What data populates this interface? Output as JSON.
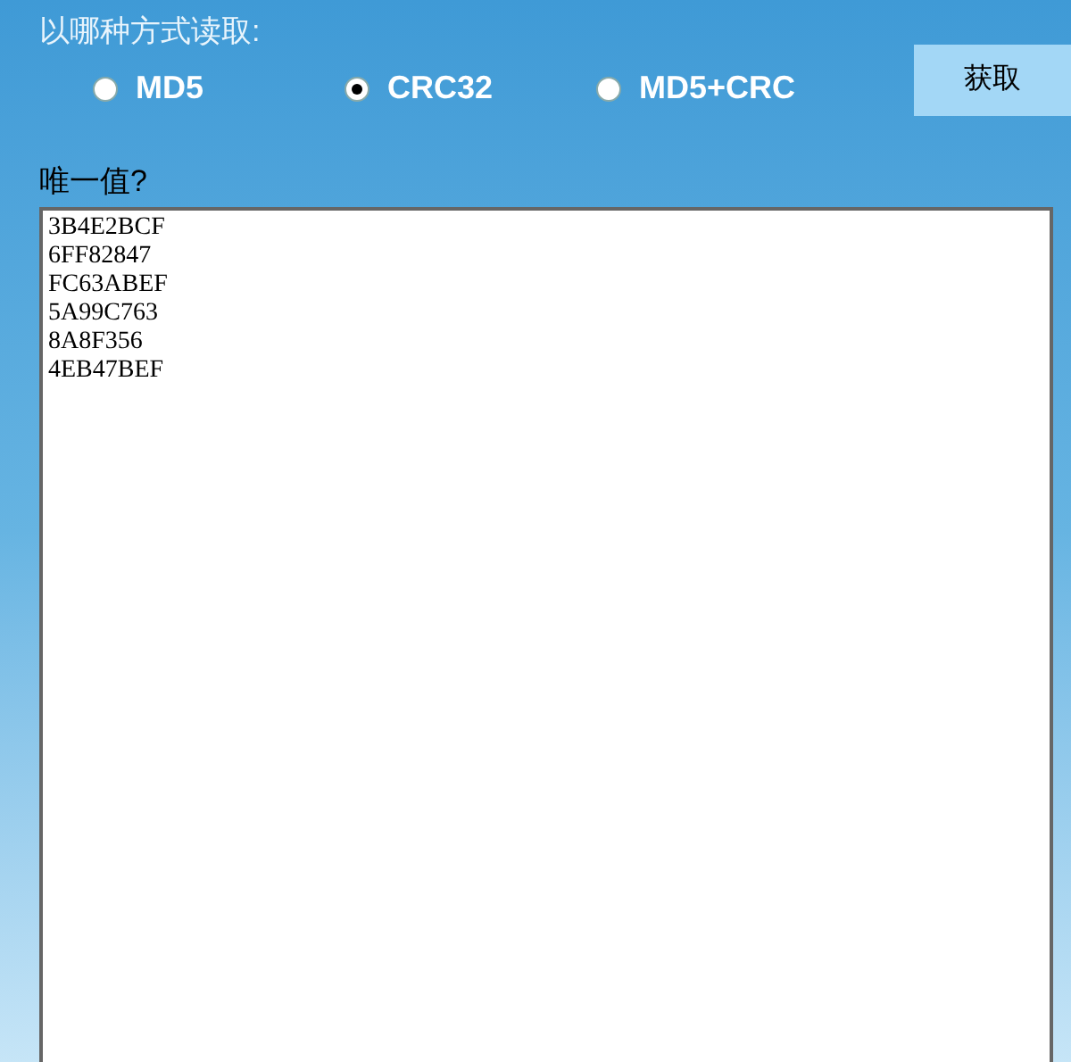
{
  "prompt": "以哪种方式读取:",
  "options": [
    {
      "label": "MD5",
      "selected": false
    },
    {
      "label": "CRC32",
      "selected": true
    },
    {
      "label": "MD5+CRC",
      "selected": false
    }
  ],
  "button": "获取",
  "result_label": "唯一值?",
  "result_lines": [
    "3B4E2BCF",
    "6FF82847",
    "FC63ABEF",
    "5A99C763",
    "8A8F356",
    "4EB47BEF"
  ]
}
